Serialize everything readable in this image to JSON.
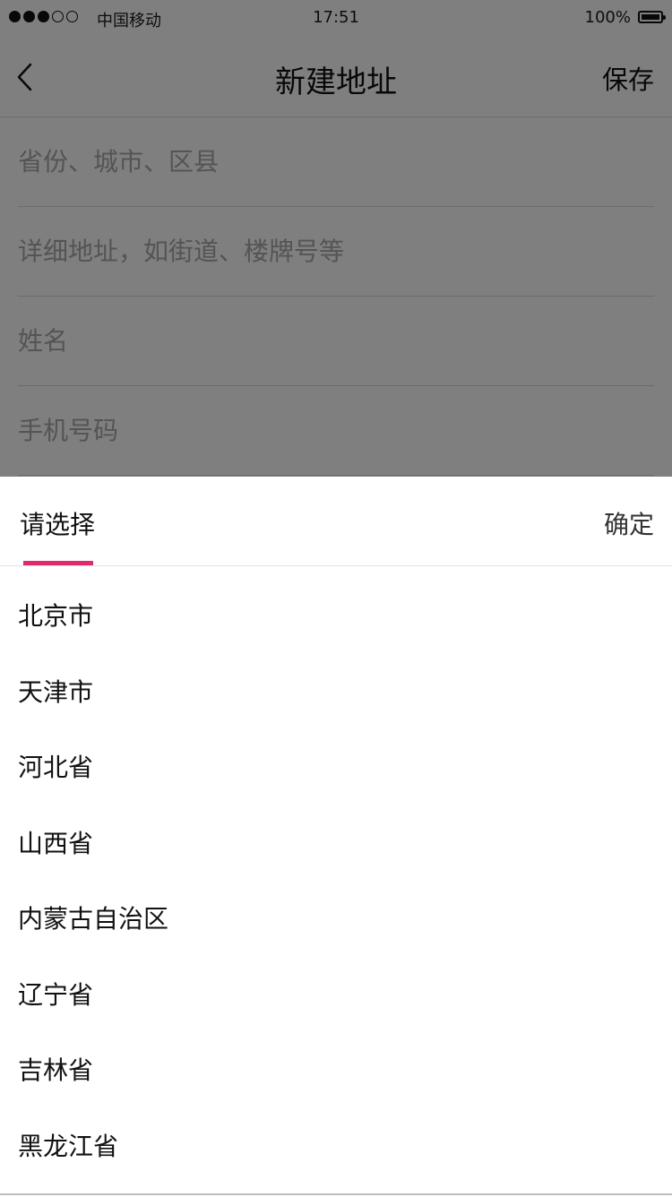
{
  "status_bar": {
    "signal_dots": [
      "full",
      "full",
      "full",
      "empty",
      "empty"
    ],
    "carrier": "中国移动",
    "time": "17:51",
    "battery": "100%"
  },
  "nav": {
    "back_icon": "chevron-left-icon",
    "title": "新建地址",
    "save_label": "保存"
  },
  "form": {
    "region_placeholder": "省份、城市、区县",
    "detail_placeholder": "详细地址，如街道、楼牌号等",
    "name_placeholder": "姓名",
    "phone_placeholder": "手机号码"
  },
  "picker": {
    "tab_label": "请选择",
    "confirm_label": "确定",
    "accent_color": "#e0296e",
    "provinces": [
      "北京市",
      "天津市",
      "河北省",
      "山西省",
      "内蒙古自治区",
      "辽宁省",
      "吉林省",
      "黑龙江省"
    ]
  }
}
